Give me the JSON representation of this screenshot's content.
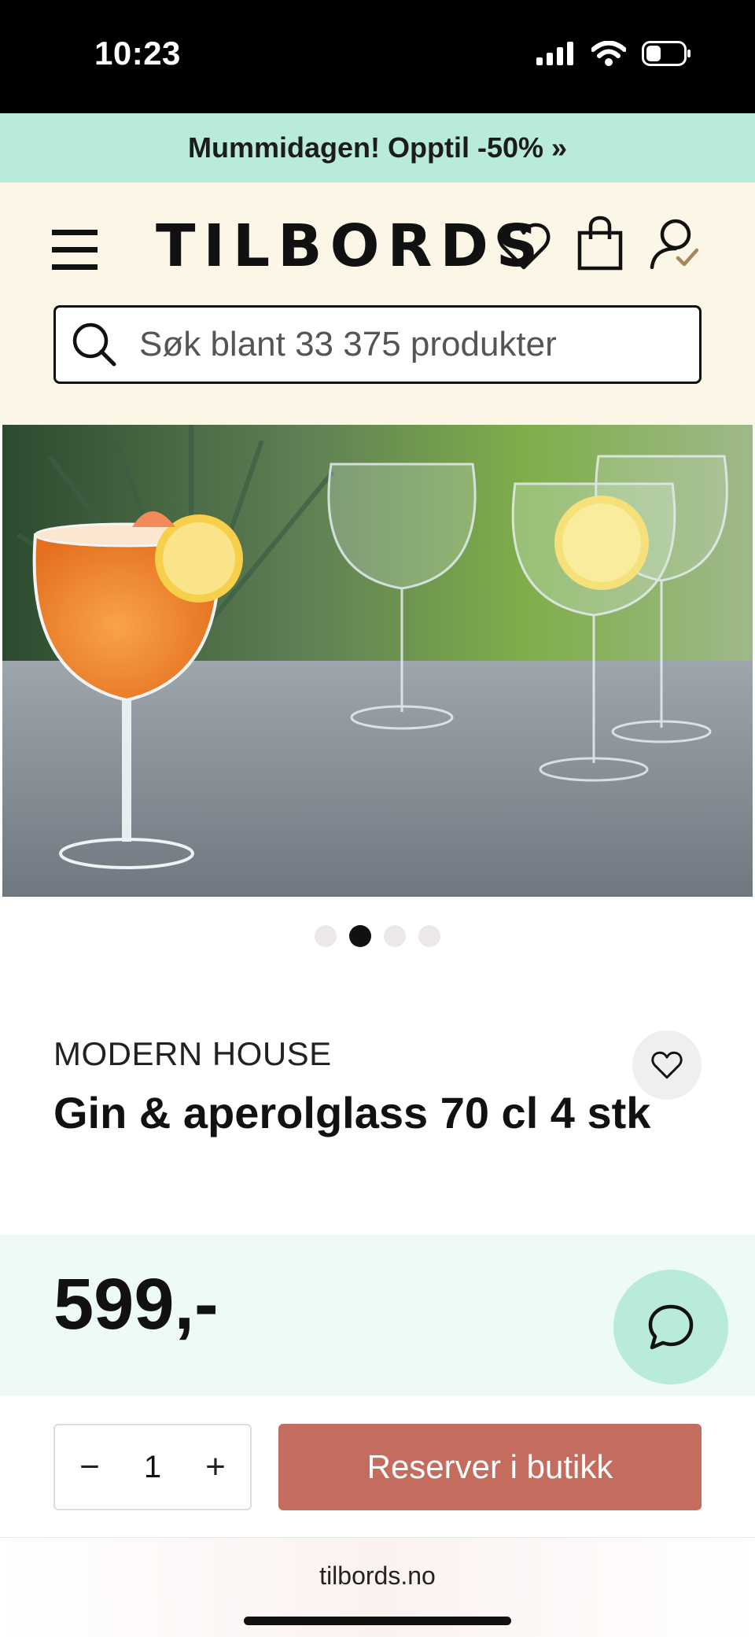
{
  "status_bar": {
    "time": "10:23"
  },
  "promo": {
    "text": "Mummidagen! Opptil -50% »"
  },
  "header": {
    "logo": "TILBORDS",
    "search_placeholder": "Søk blant 33 375 produkter",
    "icons": [
      "menu-icon",
      "heart-icon",
      "shopping-bag-icon",
      "account-icon"
    ]
  },
  "carousel": {
    "total_slides": 4,
    "active_slide": 2
  },
  "product": {
    "brand": "MODERN HOUSE",
    "title": "Gin & aperolglass 70 cl 4 stk",
    "price": "599,-"
  },
  "purchase": {
    "quantity": "1",
    "minus": "−",
    "plus": "+",
    "reserve_label": "Reserver i butikk"
  },
  "browser": {
    "url": "tilbords.no"
  },
  "colors": {
    "promo_bg": "#b9ecd8",
    "header_bg": "#fcf6e6",
    "price_band_bg": "#eefaf5",
    "reserve_button": "#c46d5e",
    "chat_button": "#b9ecd8"
  }
}
